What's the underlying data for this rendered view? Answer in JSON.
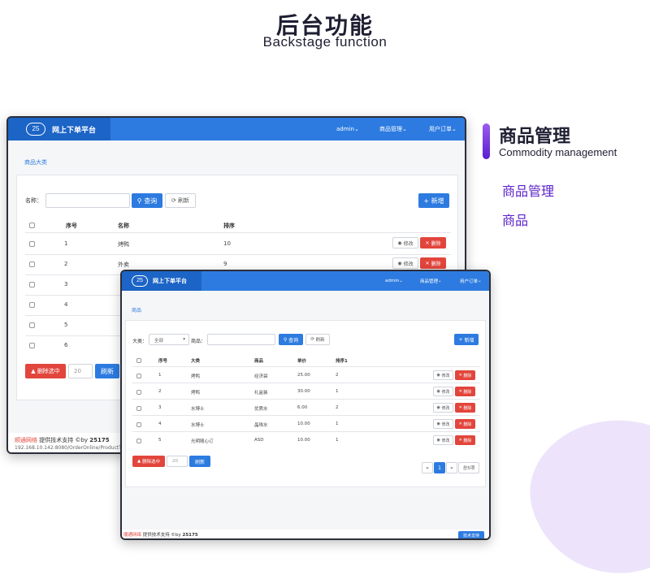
{
  "headline": {
    "cn": "后台功能",
    "en": "Backstage function"
  },
  "feature": {
    "title": "商品管理",
    "subtitle": "Commodity management",
    "items": [
      "商品管理",
      "商品"
    ]
  },
  "back_window": {
    "brand": "网上下单平台",
    "nav": [
      "admin",
      "商品管理",
      "用户订单"
    ],
    "breadcrumb": "商品大类",
    "search_label": "名称：",
    "search_button": "查询",
    "refresh_button": "刷新",
    "add_button": "新增",
    "columns": [
      "序号",
      "名称",
      "排序"
    ],
    "rows": [
      [
        "1",
        "烤鸭",
        "10"
      ],
      [
        "2",
        "外卖",
        "9"
      ],
      [
        "3",
        "",
        ""
      ],
      [
        "4",
        "",
        ""
      ],
      [
        "5",
        "",
        ""
      ],
      [
        "6",
        "",
        ""
      ]
    ],
    "row_edit": "修改",
    "row_delete": "删除",
    "batch_delete": "删除选中",
    "page_size": "20",
    "footer_brand": "顺通网络",
    "footer_text": " 提供技术支持 ©by ",
    "footer_num": "25175",
    "footer_url": "192.168.10.142:8080/OrderOnline/ProductTyp"
  },
  "front_window": {
    "brand": "网上下单平台",
    "nav": [
      "admin",
      "商品管理",
      "用户订单"
    ],
    "breadcrumb": "商品",
    "category_label": "大类：",
    "category_value": "全部",
    "product_label": "商品：",
    "search_button": "查询",
    "refresh_button": "刷新",
    "add_button": "新增",
    "columns": [
      "序号",
      "大类",
      "商品",
      "单价",
      "排序1"
    ],
    "rows": [
      [
        "1",
        "烤鸭",
        "经济袋",
        "25.00",
        "2"
      ],
      [
        "2",
        "烤鸭",
        "礼盒装",
        "30.00",
        "1"
      ],
      [
        "3",
        "水博士",
        "优质水",
        "6.00",
        "2"
      ],
      [
        "4",
        "水博士",
        "晶珠水",
        "10.00",
        "1"
      ],
      [
        "5",
        "光明随心订",
        "ASD",
        "10.00",
        "1"
      ]
    ],
    "row_edit": "修改",
    "row_delete": "删除",
    "batch_delete": "删除选中",
    "page_size": "20",
    "refresh_bottom": "刷新",
    "pagination": {
      "prev": "«",
      "current": "1",
      "next": "»",
      "total": "总5项"
    },
    "footer_brand": "顺通网络",
    "footer_text": " 提供技术支持 ©by ",
    "footer_num": "25175",
    "footer_button": "技术支持"
  },
  "colors": {
    "primary": "#2d7be0",
    "danger": "#e2453c",
    "accent": "#5b1fc9"
  }
}
